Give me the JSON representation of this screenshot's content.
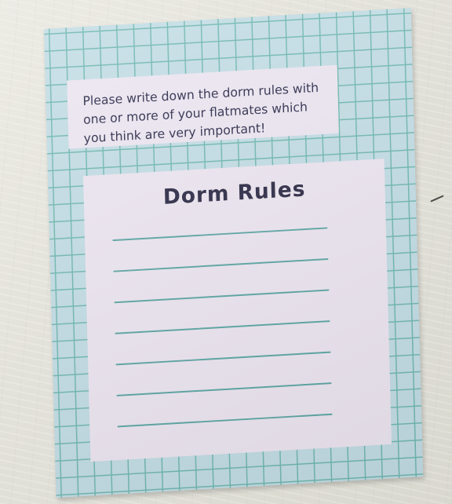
{
  "card": {
    "prompt": "Please write down the dorm rules with one or more of your flatmates which you think are very important!",
    "title": "Dorm Rules",
    "blank_lines": 7
  },
  "colors": {
    "grid_background": "#c3dde5",
    "grid_lines": "#6fb8b0",
    "paper": "#ede6f1",
    "ink": "#2c2a46",
    "writing_lines": "#5da7a4",
    "tabletop": "#e6e5de"
  }
}
